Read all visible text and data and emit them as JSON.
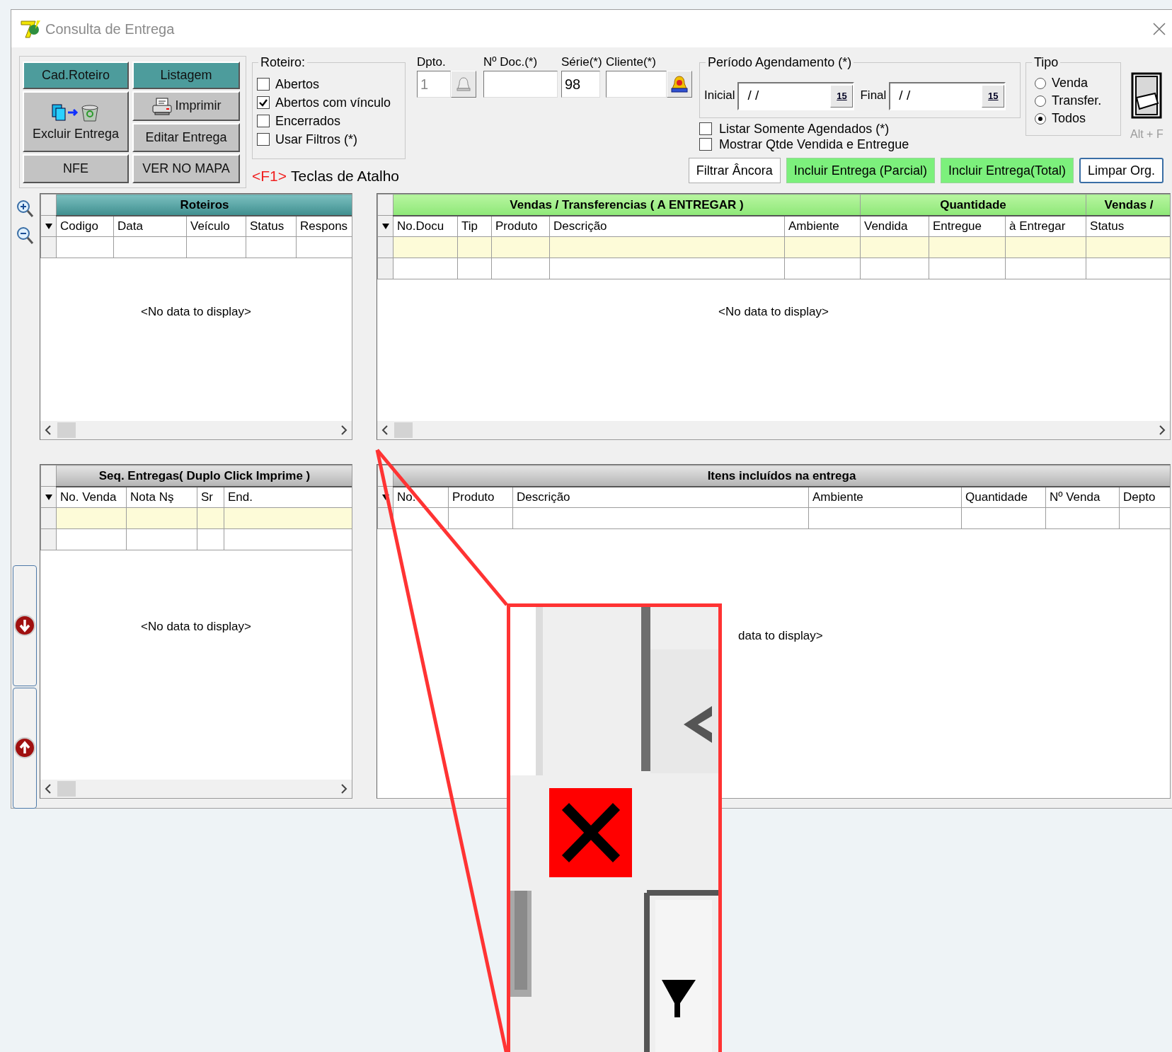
{
  "window": {
    "title": "Consulta de Entrega"
  },
  "toolbar_buttons": [
    {
      "label": "Cad.Roteiro",
      "kind": "teal"
    },
    {
      "label": "Listagem",
      "kind": "teal"
    },
    {
      "label": "Excluir Entrega",
      "kind": "delete"
    },
    {
      "label": "Imprimir",
      "kind": "print"
    },
    {
      "label": "Editar Entrega",
      "kind": "plain"
    },
    {
      "label": "NFE",
      "kind": "plain"
    },
    {
      "label": "VER NO MAPA",
      "kind": "plain"
    }
  ],
  "roteiro": {
    "title": "Roteiro:",
    "options": [
      {
        "label": "Abertos",
        "checked": false
      },
      {
        "label": "Abertos com vínculo",
        "checked": true
      },
      {
        "label": "Encerrados",
        "checked": false
      },
      {
        "label": "Usar Filtros (*)",
        "checked": false
      }
    ]
  },
  "shortcut": {
    "key": "<F1>",
    "label": "Teclas de Atalho"
  },
  "fields": [
    {
      "label": "Dpto.",
      "placeholder": "1",
      "kind": "lookup"
    },
    {
      "label": "Nº Doc.(*)",
      "kind": "text"
    },
    {
      "label": "Série(*)",
      "value": "98",
      "kind": "text"
    },
    {
      "label": "Cliente(*)",
      "kind": "client-lookup"
    }
  ],
  "period": {
    "title": "Período Agendamento (*)",
    "dates": [
      {
        "label": "Inicial",
        "value": "/ /",
        "calendar": "15"
      },
      {
        "label": "Final",
        "value": "/ /",
        "calendar": "15"
      }
    ]
  },
  "filters": [
    {
      "label": "Listar Somente Agendados (*)",
      "checked": false
    },
    {
      "label": "Mostrar Qtde Vendida e Entregue",
      "checked": false
    }
  ],
  "tipo": {
    "title": "Tipo",
    "options": [
      {
        "label": "Venda",
        "selected": false
      },
      {
        "label": "Transfer.",
        "selected": false
      },
      {
        "label": "Todos",
        "selected": true
      }
    ]
  },
  "door_hint": "Alt + F",
  "actions": [
    {
      "label": "Filtrar Âncora",
      "kind": "white"
    },
    {
      "label": "Incluir Entrega (Parcial)",
      "kind": "green"
    },
    {
      "label": "Incluir Entrega(Total)",
      "kind": "green"
    },
    {
      "label": "Limpar Org.",
      "kind": "outline"
    }
  ],
  "grids": [
    {
      "bands": [
        {
          "label": "Roteiros",
          "kind": "teal",
          "columns": [
            "Codigo",
            "Data",
            "Veículo",
            "Status",
            "Respons"
          ]
        }
      ],
      "filter_row": false,
      "empty_text": "<No data to display>",
      "scrollbar": true
    },
    {
      "bands": [
        {
          "label": "Vendas / Transferencias ( A ENTREGAR )",
          "kind": "green",
          "columns": [
            "No.Docu",
            "Tip",
            "Produto",
            "Descrição",
            "Ambiente"
          ]
        },
        {
          "label": "Quantidade",
          "kind": "green",
          "columns": [
            "Vendida",
            "Entregue",
            "à Entregar"
          ]
        },
        {
          "label": "Vendas /",
          "kind": "green",
          "columns": [
            "Status"
          ]
        }
      ],
      "filter_row": true,
      "empty_text": "<No data to display>",
      "scrollbar": true
    },
    {
      "bands": [
        {
          "label": "Seq. Entregas( Duplo Click Imprime )",
          "kind": "gray",
          "columns": [
            "No. Venda",
            "Nota Nş",
            "Sr",
            "End."
          ]
        }
      ],
      "filter_row": true,
      "empty_text": "<No data to display>",
      "scrollbar": true
    },
    {
      "bands": [
        {
          "label": "Itens incluídos na entrega",
          "kind": "gray",
          "columns": [
            "No.",
            "Produto",
            "Descrição",
            "Ambiente",
            "Quantidade",
            "Nº Venda",
            "Depto"
          ]
        }
      ],
      "filter_row": false,
      "empty_text": "data to display>",
      "scrollbar": false
    }
  ],
  "callout": {
    "kind": "zoom"
  }
}
